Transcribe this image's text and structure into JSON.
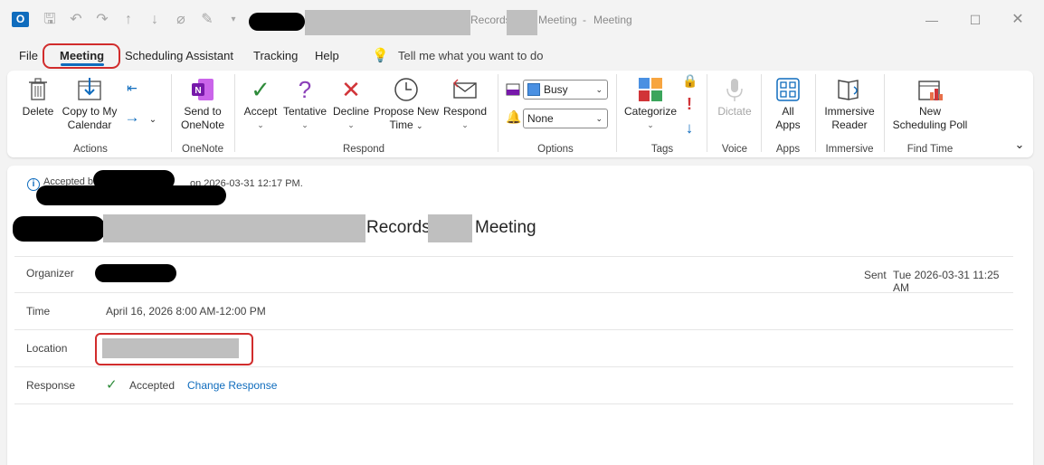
{
  "window": {
    "title_part1": "Records",
    "title_part2": "Meeting",
    "title_separator": "-",
    "title_part3": "Meeting",
    "controls": [
      "minimize-icon",
      "maximize-icon",
      "close-icon"
    ]
  },
  "quick_access": [
    "save-icon",
    "undo-icon",
    "redo-icon",
    "up-icon",
    "down-icon",
    "attach-icon",
    "signature-icon",
    "customize-icon"
  ],
  "menu": {
    "items": [
      "File",
      "Meeting",
      "Scheduling Assistant",
      "Tracking",
      "Help"
    ],
    "active": "Meeting",
    "tell_me": "Tell me what you want to do"
  },
  "ribbon": {
    "delete": "Delete",
    "copy_to_calendar_1": "Copy to My",
    "copy_to_calendar_2": "Calendar",
    "group_actions": "Actions",
    "send_to_onenote_1": "Send to",
    "send_to_onenote_2": "OneNote",
    "group_onenote": "OneNote",
    "accept": "Accept",
    "tentative": "Tentative",
    "decline": "Decline",
    "propose_1": "Propose New",
    "propose_2": "Time",
    "respond": "Respond",
    "group_respond": "Respond",
    "show_as": "Busy",
    "reminder": "None",
    "group_options": "Options",
    "categorize": "Categorize",
    "group_tags": "Tags",
    "dictate": "Dictate",
    "group_voice": "Voice",
    "all_apps_1": "All",
    "all_apps_2": "Apps",
    "group_apps": "Apps",
    "immersive_1": "Immersive",
    "immersive_2": "Reader",
    "group_immersive": "Immersive",
    "poll_1": "New",
    "poll_2": "Scheduling Poll",
    "group_find_time": "Find Time"
  },
  "message": {
    "accepted_prefix": "Accepted b",
    "accepted_suffix": "on 2026-03-31 12:17 PM.",
    "subject_part1": "Records",
    "subject_part2": "Meeting",
    "organizer_label": "Organizer",
    "sent_label": "Sent",
    "sent_value": "Tue 2026-03-31 11:25 AM",
    "time_label": "Time",
    "time_value": "April 16, 2026 8:00 AM-12:00 PM",
    "location_label": "Location",
    "response_label": "Response",
    "response_value": "Accepted",
    "change_response": "Change Response"
  },
  "colors": {
    "accent": "#0f6cbd",
    "annotation_red": "#d12c2c",
    "accept_green": "#2e8b3a",
    "decline_red": "#d13438"
  }
}
